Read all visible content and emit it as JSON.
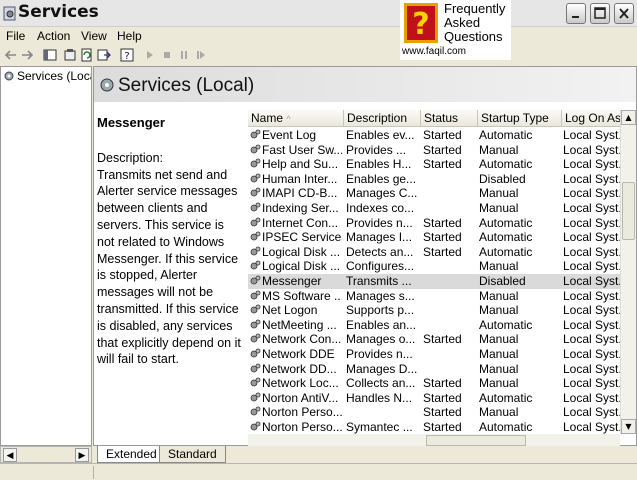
{
  "window": {
    "title": "Services"
  },
  "logo": {
    "line1": "Frequently",
    "line2": "Asked",
    "line3": "Questions",
    "url": "www.faqil.com"
  },
  "menu": [
    "File",
    "Action",
    "View",
    "Help"
  ],
  "tree": {
    "item": "Services (Local)"
  },
  "main": {
    "title": "Services (Local)"
  },
  "detail": {
    "name": "Messenger",
    "desc_label": "Description:",
    "desc_text": "Transmits net send and Alerter service messages between clients and servers. This service is not related to Windows Messenger. If this service is stopped, Alerter messages will not be transmitted. If this service is disabled, any services that explicitly depend on it will fail to start."
  },
  "columns": [
    "Name",
    "Description",
    "Status",
    "Startup Type",
    "Log On As"
  ],
  "services": [
    {
      "name": "Event Log",
      "desc": "Enables ev...",
      "status": "Started",
      "startup": "Automatic",
      "logon": "Local Syst..."
    },
    {
      "name": "Fast User Sw...",
      "desc": "Provides ...",
      "status": "Started",
      "startup": "Manual",
      "logon": "Local Syst..."
    },
    {
      "name": "Help and Su...",
      "desc": "Enables H...",
      "status": "Started",
      "startup": "Automatic",
      "logon": "Local Syst..."
    },
    {
      "name": "Human Inter...",
      "desc": "Enables ge...",
      "status": "",
      "startup": "Disabled",
      "logon": "Local Syst..."
    },
    {
      "name": "IMAPI CD-B...",
      "desc": "Manages C...",
      "status": "",
      "startup": "Manual",
      "logon": "Local Syst..."
    },
    {
      "name": "Indexing Ser...",
      "desc": "Indexes co...",
      "status": "",
      "startup": "Manual",
      "logon": "Local Syst..."
    },
    {
      "name": "Internet Con...",
      "desc": "Provides n...",
      "status": "Started",
      "startup": "Automatic",
      "logon": "Local Syst..."
    },
    {
      "name": "IPSEC Services",
      "desc": "Manages I...",
      "status": "Started",
      "startup": "Automatic",
      "logon": "Local Syst..."
    },
    {
      "name": "Logical Disk ...",
      "desc": "Detects an...",
      "status": "Started",
      "startup": "Automatic",
      "logon": "Local Syst..."
    },
    {
      "name": "Logical Disk ...",
      "desc": "Configures...",
      "status": "",
      "startup": "Manual",
      "logon": "Local Syst..."
    },
    {
      "name": "Messenger",
      "desc": "Transmits ...",
      "status": "",
      "startup": "Disabled",
      "logon": "Local Syst..."
    },
    {
      "name": "MS Software ...",
      "desc": "Manages s...",
      "status": "",
      "startup": "Manual",
      "logon": "Local Syst..."
    },
    {
      "name": "Net Logon",
      "desc": "Supports p...",
      "status": "",
      "startup": "Manual",
      "logon": "Local Syst..."
    },
    {
      "name": "NetMeeting ...",
      "desc": "Enables an...",
      "status": "",
      "startup": "Automatic",
      "logon": "Local Syst..."
    },
    {
      "name": "Network Con...",
      "desc": "Manages o...",
      "status": "Started",
      "startup": "Manual",
      "logon": "Local Syst..."
    },
    {
      "name": "Network DDE",
      "desc": "Provides n...",
      "status": "",
      "startup": "Manual",
      "logon": "Local Syst..."
    },
    {
      "name": "Network DD...",
      "desc": "Manages D...",
      "status": "",
      "startup": "Manual",
      "logon": "Local Syst..."
    },
    {
      "name": "Network Loc...",
      "desc": "Collects an...",
      "status": "Started",
      "startup": "Manual",
      "logon": "Local Syst..."
    },
    {
      "name": "Norton AntiV...",
      "desc": "Handles N...",
      "status": "Started",
      "startup": "Automatic",
      "logon": "Local Syst..."
    },
    {
      "name": "Norton Perso...",
      "desc": "",
      "status": "Started",
      "startup": "Manual",
      "logon": "Local Syst..."
    },
    {
      "name": "Norton Perso...",
      "desc": "Symantec ...",
      "status": "Started",
      "startup": "Automatic",
      "logon": "Local Syst..."
    }
  ],
  "selected_index": 10,
  "tabs": [
    "Extended",
    "Standard"
  ]
}
